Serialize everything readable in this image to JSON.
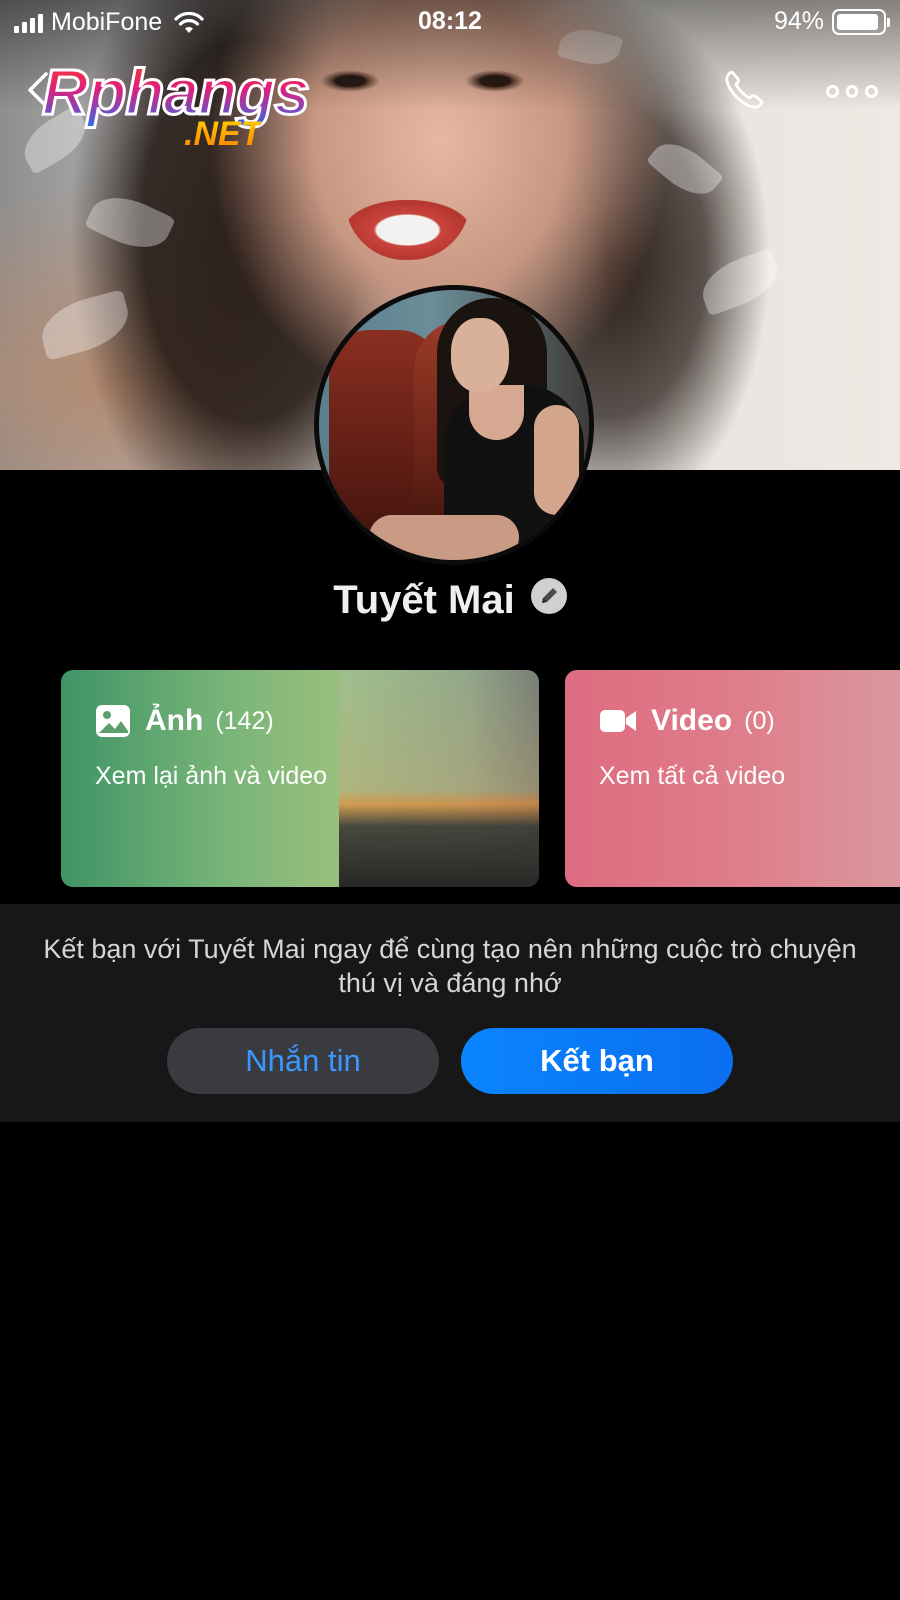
{
  "status_bar": {
    "carrier": "MobiFone",
    "time": "08:12",
    "battery": "94%",
    "battery_level": 0.94
  },
  "nav": {
    "back_icon": "chevron-left-icon",
    "call_icon": "phone-icon",
    "more_icon": "more-dots-icon"
  },
  "watermark": {
    "main": "Rphangs",
    "sub": ".NET"
  },
  "profile": {
    "name": "Tuyết Mai",
    "edit_icon": "pencil-icon"
  },
  "cards": {
    "photos": {
      "title": "Ảnh",
      "count": "(142)",
      "subtitle": "Xem lại ảnh và video",
      "icon": "image-icon"
    },
    "videos": {
      "title": "Video",
      "count": "(0)",
      "subtitle": "Xem tất cả video",
      "icon": "video-camera-icon"
    }
  },
  "friend_panel": {
    "message": "Kết bạn với Tuyết Mai ngay để cùng tạo nên những cuộc trò chuyện thú vị và đáng nhớ",
    "message_button": "Nhắn tin",
    "add_friend_button": "Kết bạn"
  },
  "colors": {
    "accent_blue": "#0a84ff",
    "message_text_blue": "#3a97ff",
    "panel_bg": "#171717",
    "photos_card": "#79b578",
    "videos_card": "#dd6c80"
  }
}
